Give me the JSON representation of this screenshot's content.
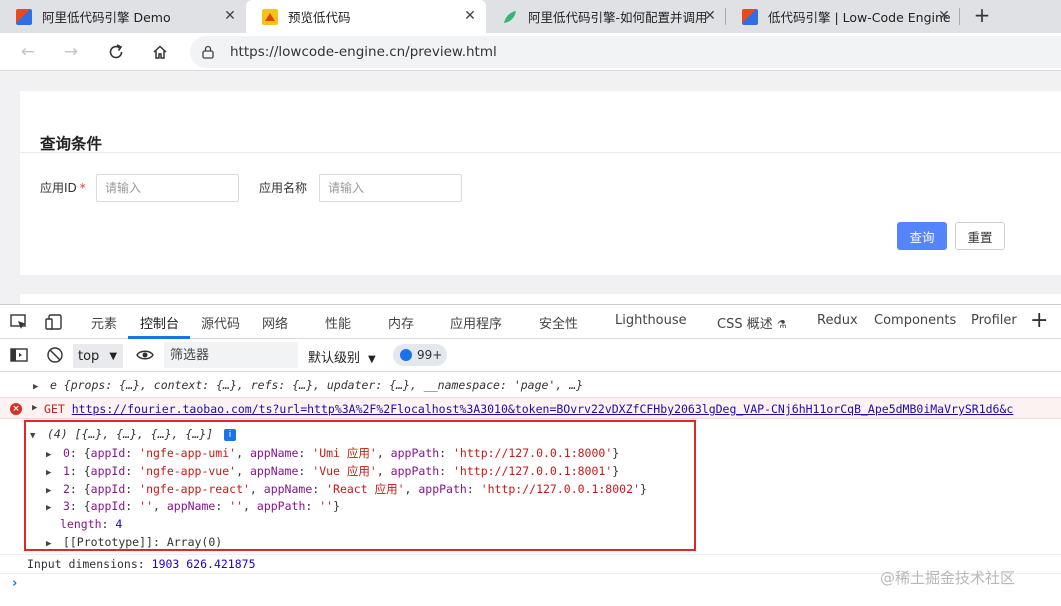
{
  "browser": {
    "tabs": [
      {
        "title": "阿里低代码引擎 Demo",
        "icon": "lowcode-logo-icon",
        "active": false
      },
      {
        "title": "预览低代码",
        "icon": "preview-favicon-icon",
        "active": true
      },
      {
        "title": "阿里低代码引擎-如何配置并调用",
        "icon": "leaf-favicon-icon",
        "active": false
      },
      {
        "title": "低代码引擎 | Low-Code Engine",
        "icon": "lowcode-logo-icon",
        "active": false
      }
    ],
    "new_tab": "+",
    "url": "https://lowcode-engine.cn/preview.html"
  },
  "page": {
    "card_title": "查询条件",
    "fields": [
      {
        "label": "应用ID",
        "required_mark": "*",
        "placeholder": "请输入"
      },
      {
        "label": "应用名称",
        "required_mark": "",
        "placeholder": "请输入"
      }
    ],
    "query_button": "查询",
    "reset_button": "重置"
  },
  "devtools": {
    "tabs": [
      "元素",
      "控制台",
      "源代码",
      "网络",
      "性能",
      "内存",
      "应用程序",
      "安全性",
      "Lighthouse",
      "CSS 概述",
      "Redux",
      "Components",
      "Profiler"
    ],
    "active_tab": "控制台",
    "context": "top",
    "filter_placeholder": "筛选器",
    "level": "默认级别",
    "issues_count": "99+",
    "console": {
      "line1": "e {props: {…}, context: {…}, refs: {…}, updater: {…}, __namespace: 'page', …}",
      "error_method": "GET",
      "error_url": "https://fourier.taobao.com/ts?url=http%3A%2F%2Flocalhost%3A3010&token=BOvrv22vDXZfCFHby2063lgDeg_VAP-CNj6hH11orCqB_Ape5dMB0iMaVrySR1d6&c",
      "array_summary": "(4) [{…}, {…}, {…}, {…}]",
      "items": [
        {
          "index": "0",
          "appId": "'ngfe-app-umi'",
          "appName": "'Umi 应用'",
          "appPath": "'http://127.0.0.1:8000'"
        },
        {
          "index": "1",
          "appId": "'ngfe-app-vue'",
          "appName": "'Vue 应用'",
          "appPath": "'http://127.0.0.1:8001'"
        },
        {
          "index": "2",
          "appId": "'ngfe-app-react'",
          "appName": "'React 应用'",
          "appPath": "'http://127.0.0.1:8002'"
        },
        {
          "index": "3",
          "appId": "''",
          "appName": "''",
          "appPath": "''"
        }
      ],
      "length_key": "length",
      "length_value": "4",
      "prototype_key": "[[Prototype]]",
      "prototype_value": "Array(0)",
      "dimensions_label": "Input dimensions:",
      "dimensions_value": "1903 626.421875",
      "prompt": "›"
    }
  },
  "watermark": "@稀土掘金技术社区",
  "colors": {
    "accent": "#1a73e8",
    "error": "#d93025",
    "primary_button": "#5584ff",
    "highlight_box": "#e0262d"
  }
}
